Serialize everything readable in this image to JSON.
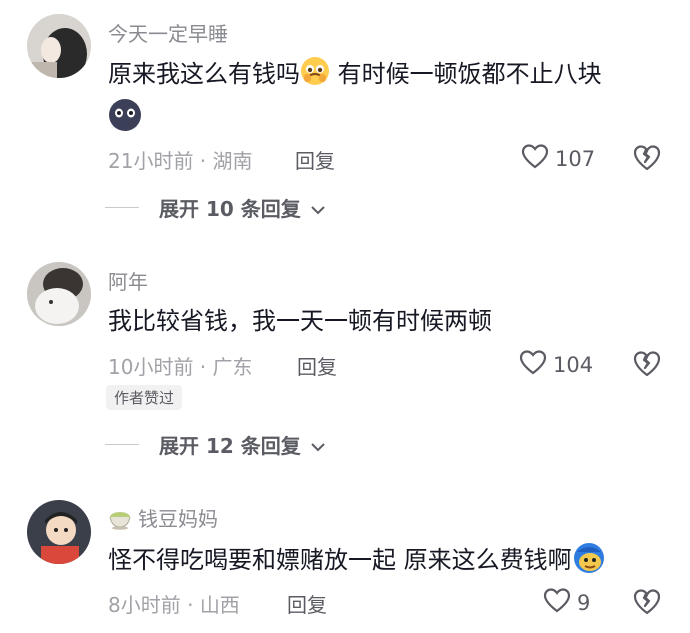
{
  "comments": [
    {
      "username": "今天一定早睡",
      "text": "原来我这么有钱吗",
      "text_after_emoji": " 有时候一顿饭都不止八块",
      "emoji_inline": "crying-face-emoji",
      "emoji_second_line": "dark-round-face-emoji",
      "time": "21小时前",
      "location": "湖南",
      "reply_label": "回复",
      "likes": "107",
      "expand_label": "展开 10 条回复"
    },
    {
      "username": "阿年",
      "text": "我比较省钱，我一天一顿有时候两顿",
      "time": "10小时前",
      "location": "广东",
      "reply_label": "回复",
      "likes": "104",
      "badge": "作者赞过",
      "expand_label": "展开 12 条回复"
    },
    {
      "username": "钱豆妈妈",
      "username_icon": "tea-cup-icon",
      "text": "怪不得吃喝要和嫖赌放一起 原来这么费钱啊",
      "emoji_inline": "doge-emoji",
      "time": "8小时前",
      "location": "山西",
      "reply_label": "回复",
      "likes": "9"
    }
  ],
  "separator": " · ",
  "colors": {
    "text": "#161823",
    "meta": "#a1a2a7",
    "username": "#8a8b91"
  }
}
